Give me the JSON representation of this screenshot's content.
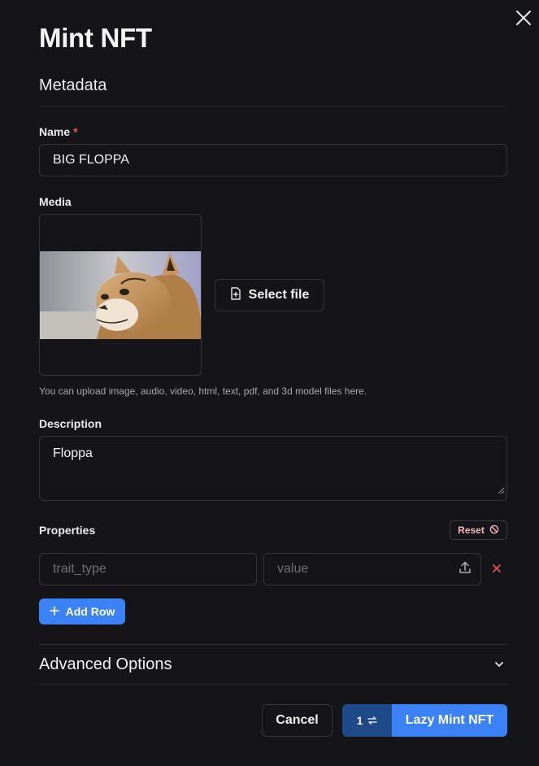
{
  "dialog": {
    "title": "Mint NFT",
    "close_icon": "close-icon"
  },
  "metadata": {
    "heading": "Metadata"
  },
  "name_field": {
    "label": "Name",
    "required_mark": "*",
    "value": "BIG FLOPPA"
  },
  "media": {
    "label": "Media",
    "image_icon": "caracal-cat-photo",
    "select_label": "Select file",
    "select_icon": "file-plus-icon",
    "hint": "You can upload image, audio, video, html, text, pdf, and 3d model files here."
  },
  "description": {
    "label": "Description",
    "value": "Floppa"
  },
  "properties": {
    "label": "Properties",
    "reset_label": "Reset",
    "reset_icon": "ban-icon",
    "rows": [
      {
        "trait_placeholder": "trait_type",
        "trait_value": "",
        "value_placeholder": "value",
        "value_value": "",
        "upload_icon": "upload-icon",
        "remove_icon": "x-icon"
      }
    ],
    "add_row_label": "Add Row",
    "add_row_icon": "plus-icon"
  },
  "advanced": {
    "label": "Advanced Options",
    "chevron_icon": "chevron-down-icon"
  },
  "footer": {
    "cancel_label": "Cancel",
    "mint_quantity": "1",
    "mint_quantity_icon": "swap-arrows-icon",
    "mint_label": "Lazy Mint NFT"
  },
  "colors": {
    "background": "#151519",
    "border": "#34343c",
    "accent": "#3b82f6",
    "accent_dark": "#1f4a8a",
    "required": "#ee5a5a",
    "reset_text": "#f4b6b6",
    "remove_icon": "#e05252"
  }
}
